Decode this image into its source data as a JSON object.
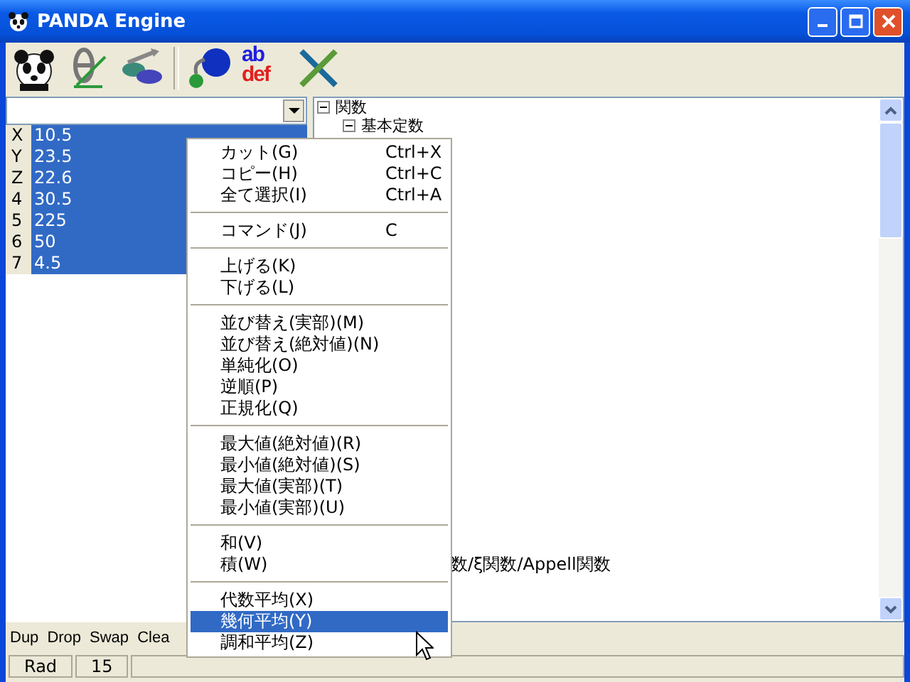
{
  "window": {
    "title": "PANDA Engine"
  },
  "toolbar": [
    {
      "kind": "panda"
    },
    {
      "kind": "theta"
    },
    {
      "kind": "numbers"
    },
    {
      "kind": "circles"
    },
    {
      "kind": "letters",
      "top": "ab",
      "bottom": "def"
    },
    {
      "kind": "cross"
    }
  ],
  "stack": [
    {
      "label": "X",
      "value": "10.5",
      "selected": true
    },
    {
      "label": "Y",
      "value": "23.5",
      "selected": true
    },
    {
      "label": "Z",
      "value": "22.6",
      "selected": true
    },
    {
      "label": "4",
      "value": "30.5",
      "selected": true
    },
    {
      "label": "5",
      "value": "225",
      "selected": true
    },
    {
      "label": "6",
      "value": "50",
      "selected": true
    },
    {
      "label": "7",
      "value": "4.5",
      "selected": true
    }
  ],
  "tree": {
    "nodes": [
      {
        "label": "関数",
        "expanded": true,
        "children": [
          {
            "label": "基本定数",
            "expanded": true
          }
        ]
      }
    ],
    "partial_line": "数/ξ関数/Appell関数"
  },
  "buttons": [
    "Dup",
    "Drop",
    "Swap",
    "Clea"
  ],
  "status_bar": [
    "Rad",
    "15"
  ],
  "context_menu": [
    {
      "kind": "item",
      "label": "カット(G)",
      "shortcut": "Ctrl+X",
      "selected": false
    },
    {
      "kind": "item",
      "label": "コピー(H)",
      "shortcut": "Ctrl+C",
      "selected": false
    },
    {
      "kind": "item",
      "label": "全て選択(I)",
      "shortcut": "Ctrl+A",
      "selected": false
    },
    {
      "kind": "separator"
    },
    {
      "kind": "item",
      "label": "コマンド(J)",
      "shortcut": "C",
      "selected": false
    },
    {
      "kind": "separator"
    },
    {
      "kind": "item",
      "label": "上げる(K)",
      "selected": false
    },
    {
      "kind": "item",
      "label": "下げる(L)",
      "selected": false
    },
    {
      "kind": "separator"
    },
    {
      "kind": "item",
      "label": "並び替え(実部)(M)",
      "selected": false
    },
    {
      "kind": "item",
      "label": "並び替え(絶対値)(N)",
      "selected": false
    },
    {
      "kind": "item",
      "label": "単純化(O)",
      "selected": false
    },
    {
      "kind": "item",
      "label": "逆順(P)",
      "selected": false
    },
    {
      "kind": "item",
      "label": "正規化(Q)",
      "selected": false
    },
    {
      "kind": "separator"
    },
    {
      "kind": "item",
      "label": "最大値(絶対値)(R)",
      "selected": false
    },
    {
      "kind": "item",
      "label": "最小値(絶対値)(S)",
      "selected": false
    },
    {
      "kind": "item",
      "label": "最大値(実部)(T)",
      "selected": false
    },
    {
      "kind": "item",
      "label": "最小値(実部)(U)",
      "selected": false
    },
    {
      "kind": "separator"
    },
    {
      "kind": "item",
      "label": "和(V)",
      "selected": false
    },
    {
      "kind": "item",
      "label": "積(W)",
      "selected": false
    },
    {
      "kind": "separator"
    },
    {
      "kind": "item",
      "label": "代数平均(X)",
      "selected": false
    },
    {
      "kind": "item",
      "label": "幾何平均(Y)",
      "selected": true
    },
    {
      "kind": "item",
      "label": "調和平均(Z)",
      "selected": false
    }
  ]
}
